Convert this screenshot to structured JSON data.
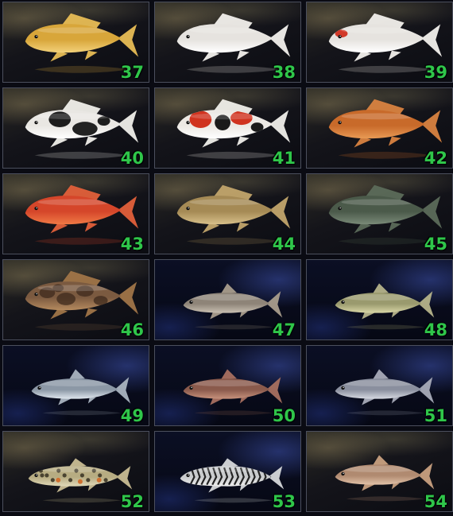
{
  "theme": {
    "number_color": "#2fc64a"
  },
  "fish": [
    {
      "id": "37",
      "bg": "gold",
      "shape": "carp",
      "body": "#d8a63a",
      "belly": "#f3d27a",
      "fin": "#e8bd55",
      "pattern": "none"
    },
    {
      "id": "38",
      "bg": "gold",
      "shape": "carp",
      "body": "#e6e3df",
      "belly": "#ffffff",
      "fin": "#f2f0ec",
      "pattern": "none"
    },
    {
      "id": "39",
      "bg": "gold",
      "shape": "carp",
      "body": "#e6e3df",
      "belly": "#ffffff",
      "fin": "#f2f0ec",
      "pattern": "redhead"
    },
    {
      "id": "40",
      "bg": "gold",
      "shape": "carp",
      "body": "#e9e7e3",
      "belly": "#ffffff",
      "fin": "#f0efea",
      "pattern": "black"
    },
    {
      "id": "41",
      "bg": "gold",
      "shape": "carp",
      "body": "#ece9e4",
      "belly": "#ffffff",
      "fin": "#f0efea",
      "pattern": "kohaku"
    },
    {
      "id": "42",
      "bg": "gold",
      "shape": "carp",
      "body": "#c86a2a",
      "belly": "#e89a55",
      "fin": "#d98340",
      "pattern": "none"
    },
    {
      "id": "43",
      "bg": "gold",
      "shape": "carp",
      "body": "#d5462a",
      "belly": "#f07a45",
      "fin": "#e2603a",
      "pattern": "none"
    },
    {
      "id": "44",
      "bg": "gold",
      "shape": "carp",
      "body": "#a58a55",
      "belly": "#d8c08a",
      "fin": "#c2a56c",
      "pattern": "none"
    },
    {
      "id": "45",
      "bg": "gold",
      "shape": "carp",
      "body": "#4b5a4a",
      "belly": "#7a8a78",
      "fin": "#5c6b5a",
      "pattern": "none"
    },
    {
      "id": "46",
      "bg": "gold",
      "shape": "carp",
      "body": "#7b5a40",
      "belly": "#b58a5e",
      "fin": "#a07548",
      "pattern": "mottled"
    },
    {
      "id": "47",
      "bg": "blue",
      "shape": "slim",
      "body": "#8e8478",
      "belly": "#c9c0b2",
      "fin": "#a99d8c",
      "pattern": "none"
    },
    {
      "id": "48",
      "bg": "blue",
      "shape": "slim",
      "body": "#9a9a6e",
      "belly": "#d8d6a6",
      "fin": "#b5b38a",
      "pattern": "none"
    },
    {
      "id": "49",
      "bg": "blue",
      "shape": "slim",
      "body": "#8c98a6",
      "belly": "#dfe6ee",
      "fin": "#aab4c0",
      "pattern": "none"
    },
    {
      "id": "50",
      "bg": "blue",
      "shape": "slim",
      "body": "#8a5a4c",
      "belly": "#c7917c",
      "fin": "#a87060",
      "pattern": "none"
    },
    {
      "id": "51",
      "bg": "blue",
      "shape": "slim",
      "body": "#8a8f9e",
      "belly": "#d6d9e2",
      "fin": "#a8abb8",
      "pattern": "none"
    },
    {
      "id": "52",
      "bg": "gold",
      "shape": "trout",
      "body": "#b7ac82",
      "belly": "#e1d9b8",
      "fin": "#c9bd94",
      "pattern": "spots"
    },
    {
      "id": "53",
      "bg": "blue",
      "shape": "trout",
      "body": "#c9cbcd",
      "belly": "#f0f0f0",
      "fin": "#d6d8da",
      "pattern": "stripes"
    },
    {
      "id": "54",
      "bg": "gold",
      "shape": "slim",
      "body": "#b08a70",
      "belly": "#e2c2a8",
      "fin": "#c8a080",
      "pattern": "none"
    }
  ]
}
